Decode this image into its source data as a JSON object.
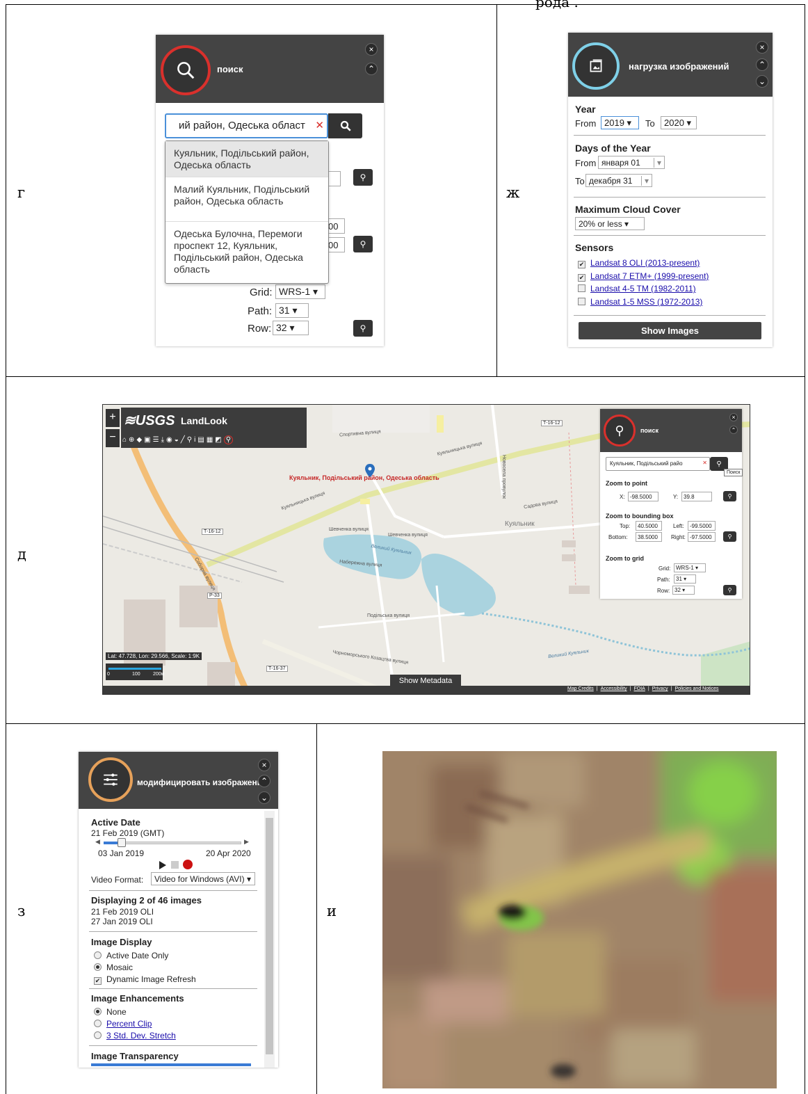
{
  "page": {
    "top_text": "рода                                     ."
  },
  "letters": {
    "g": "г",
    "zh": "ж",
    "d": "д",
    "z": "з",
    "i": "и"
  },
  "search_panel": {
    "title": "поиск",
    "close": "×",
    "collapse": "⌃",
    "input_value": "ий район, Одеська област",
    "clear": "✕",
    "suggestions": [
      "Куяльник, Подільський район, Одеська область",
      "Малий Куяльник, Подільський район, Одеська область",
      "Одеська Булочна, Перемоги проспект 12, Куяльник, Подільський район, Одеська область"
    ],
    "peek_values": [
      "00",
      "00"
    ],
    "grid_label": "Grid:",
    "grid_value": "WRS-1 ▾",
    "path_label": "Path:",
    "path_value": "31 ▾",
    "row_label": "Row:",
    "row_value": "32 ▾"
  },
  "load_panel": {
    "title": "нагрузка изображений",
    "year": {
      "heading": "Year",
      "from_label": "From",
      "from_value": "2019 ▾",
      "to_label": "To",
      "to_value": "2020 ▾"
    },
    "days": {
      "heading": "Days of the Year",
      "from_label": "From",
      "from_value": "января 01",
      "to_label": "To",
      "to_value": "декабря 31"
    },
    "cloud": {
      "heading": "Maximum Cloud Cover",
      "value": "20% or less ▾"
    },
    "sensors": {
      "heading": "Sensors",
      "items": [
        {
          "label": "Landsat 8 OLI (2013-present)",
          "checked": "✔"
        },
        {
          "label": "Landsat 7 ETM+ (1999-present)",
          "checked": "✔"
        },
        {
          "label": "Landsat 4-5 TM (1982-2011)",
          "checked": ""
        },
        {
          "label": "Landsat 1-5 MSS (1972-2013)",
          "checked": ""
        }
      ]
    },
    "show_button": "Show Images"
  },
  "map": {
    "zoom_in": "+",
    "zoom_out": "−",
    "logo": "≋USGS",
    "app_name": "LandLook",
    "tool_icons": [
      "⌂",
      "⊕",
      "◆",
      "▣",
      "☰",
      "⤓",
      "◉",
      "◒",
      "╱",
      "⚲",
      "i",
      "▤",
      "▦",
      "◩",
      "⚲"
    ],
    "marker_label": "Куяльник, Подільський район, Одеська область",
    "street_labels": [
      "Спортивна вулиця",
      "Куяльницька вулиця",
      "Шевченка вулиця",
      "Набережна вулиця",
      "Подільська вулиця",
      "Чорноморського Козацтва вулиця",
      "Соборна вулиця",
      "Новосела провулок",
      "Садова вулиця",
      "Шевченка вулиця"
    ],
    "road_badges": [
      "Т-16-12",
      "Т-16-12",
      "Р-33",
      "Т-16-37"
    ],
    "lake_labels": [
      "Великий Куяльник",
      "Великий Куяльник"
    ],
    "village_label": "Куяльник",
    "coords": "Lat: 47.728, Lon: 29.566, Scale: 1:9K",
    "scale_ticks": [
      "0",
      "100",
      "200м"
    ],
    "show_metadata": "Show Metadata",
    "footer_links": [
      "Map Credits",
      "Accessibility",
      "FOIA",
      "Privacy",
      "Policies and Notices"
    ],
    "tooltip": "Поиск",
    "mini_panel": {
      "title": "поиск",
      "input_value": "Куяльник, Подільський райо",
      "clear": "✕",
      "zoom_point": "Zoom to point",
      "x_label": "X:",
      "x_value": "-98.5000",
      "y_label": "Y:",
      "y_value": "39.8",
      "zoom_box": "Zoom to bounding box",
      "top_label": "Top:",
      "top_value": "40.5000",
      "left_label": "Left:",
      "left_value": "-99.5000",
      "bottom_label": "Bottom:",
      "bottom_value": "38.5000",
      "right_label": "Right:",
      "right_value": "-97.5000",
      "zoom_grid": "Zoom to grid",
      "grid_label": "Grid:",
      "grid_value": "WRS-1 ▾",
      "path_label": "Path:",
      "path_value": "31 ▾",
      "row_label": "Row:",
      "row_value": "32 ▾"
    }
  },
  "modify_panel": {
    "title": "модифицировать изображений",
    "active_date": {
      "heading": "Active Date",
      "value": "21 Feb 2019 (GMT)",
      "start": "03 Jan 2019",
      "end": "20 Apr 2020",
      "slider_fraction": 0.09
    },
    "video_label": "Video Format:",
    "video_value": "Video for Windows (AVI) ▾",
    "displaying": {
      "heading": "Displaying 2 of 46 images",
      "items": [
        "21 Feb 2019 OLI",
        "27 Jan 2019 OLI"
      ]
    },
    "image_display": {
      "heading": "Image Display",
      "items": [
        "Active Date Only",
        "Mosaic",
        "Dynamic Image Refresh"
      ]
    },
    "enhancements": {
      "heading": "Image Enhancements",
      "items": [
        "None",
        "Percent Clip",
        "3 Std. Dev. Stretch"
      ]
    },
    "transparency": {
      "heading": "Image Transparency"
    }
  },
  "colors": {
    "search_ring": "#d9302c",
    "load_ring": "#7fd0e8",
    "modify_ring": "#e6a15a",
    "panel_header": "#444444"
  }
}
